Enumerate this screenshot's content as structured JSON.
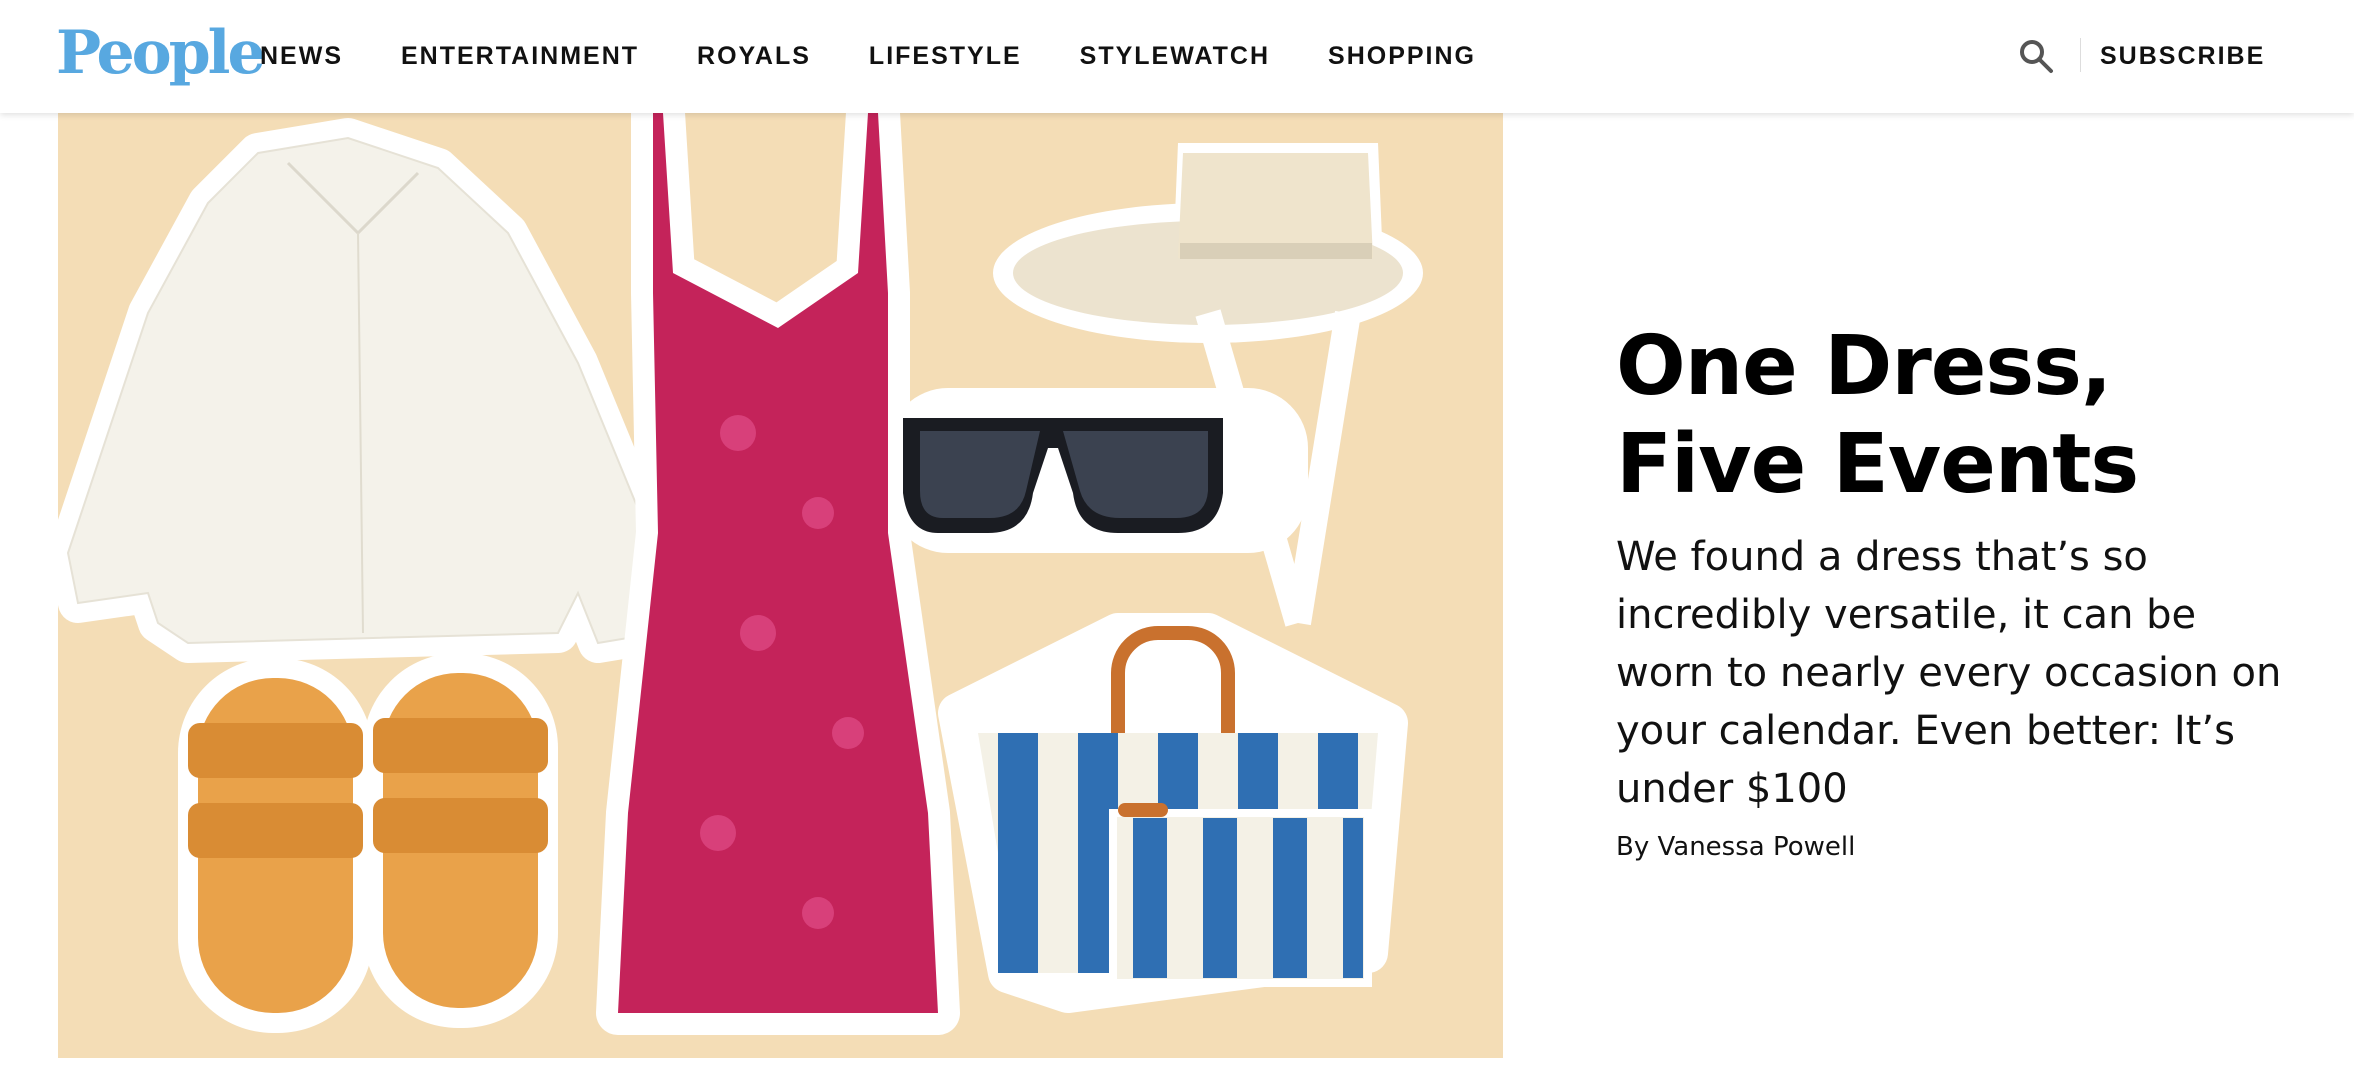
{
  "header": {
    "logo": "People",
    "nav": [
      "NEWS",
      "ENTERTAINMENT",
      "ROYALS",
      "LIFESTYLE",
      "STYLEWATCH",
      "SHOPPING"
    ],
    "search_icon": "search-icon",
    "subscribe_label": "SUBSCRIBE"
  },
  "article": {
    "headline": "One Dress, Five Events",
    "dek": "We found a dress that’s so incredibly versatile, it can be worn to nearly every occasion on your calendar. Even better: It’s under $100",
    "byline_prefix": "By ",
    "author": "Vanessa Powell"
  },
  "colors": {
    "logo_blue": "#58a8e0",
    "hero_background": "#f4ddb6",
    "dress": "#c4235a",
    "sandals": "#e9a24a",
    "tote_stripe": "#2f6fb3"
  }
}
